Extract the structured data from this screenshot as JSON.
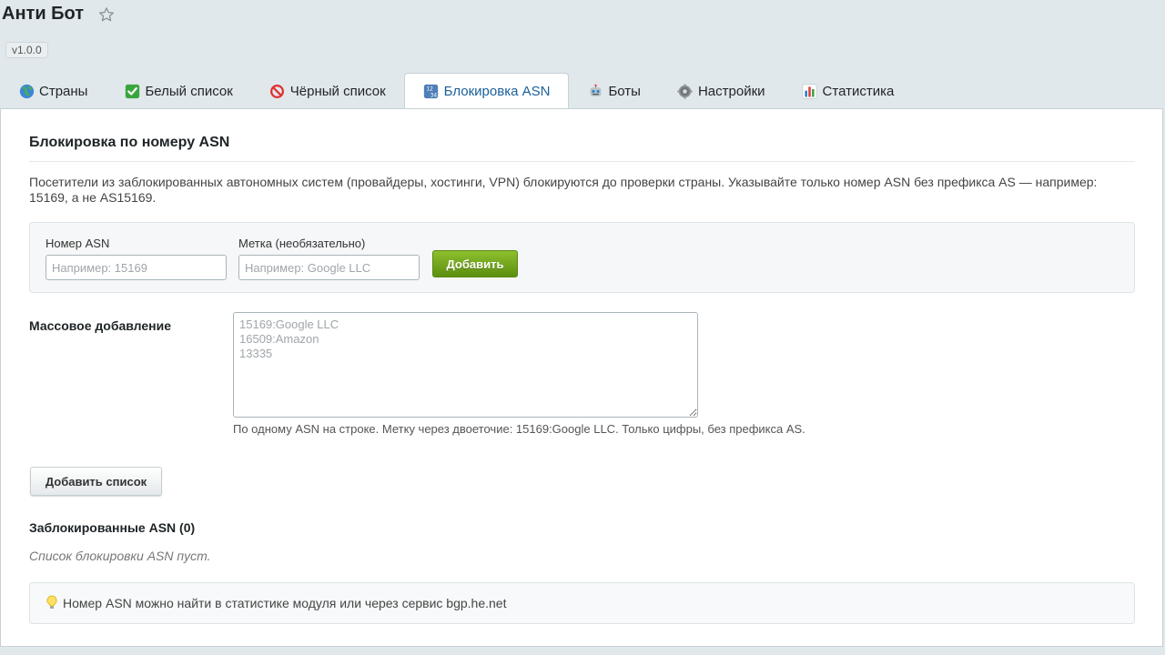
{
  "header": {
    "title": "Анти Бот",
    "version": "v1.0.0"
  },
  "tabs": [
    {
      "label": "Страны",
      "icon": "globe-icon",
      "active": false
    },
    {
      "label": "Белый список",
      "icon": "check-icon",
      "active": false
    },
    {
      "label": "Чёрный список",
      "icon": "prohibited-icon",
      "active": false
    },
    {
      "label": "Блокировка ASN",
      "icon": "numbers-icon",
      "active": true
    },
    {
      "label": "Боты",
      "icon": "robot-icon",
      "active": false
    },
    {
      "label": "Настройки",
      "icon": "gear-icon",
      "active": false
    },
    {
      "label": "Статистика",
      "icon": "bar-chart-icon",
      "active": false
    }
  ],
  "main": {
    "section_title": "Блокировка по номеру ASN",
    "description": "Посетители из заблокированных автономных систем (провайдеры, хостинги, VPN) блокируются до проверки страны. Указывайте только номер ASN без префикса AS — например: 15169, а не AS15169.",
    "form": {
      "asn_label": "Номер ASN",
      "asn_placeholder": "Например: 15169",
      "asn_value": "",
      "tag_label": "Метка (необязательно)",
      "tag_placeholder": "Например: Google LLC",
      "tag_value": "",
      "add_button": "Добавить"
    },
    "bulk": {
      "label": "Массовое добавление",
      "placeholder": "15169:Google LLC\n16509:Amazon\n13335",
      "hint": "По одному ASN на строке. Метку через двоеточие: 15169:Google LLC. Только цифры, без префикса AS.",
      "button": "Добавить список"
    },
    "blocked": {
      "title": "Заблокированные ASN (0)",
      "empty_text": "Список блокировки ASN пуст."
    },
    "tip": "Номер ASN можно найти в статистике модуля или через сервис bgp.he.net"
  },
  "colors": {
    "background": "#e0e8ec",
    "active_tab_text": "#1a5f99",
    "add_button_green": "#6fa31a"
  }
}
